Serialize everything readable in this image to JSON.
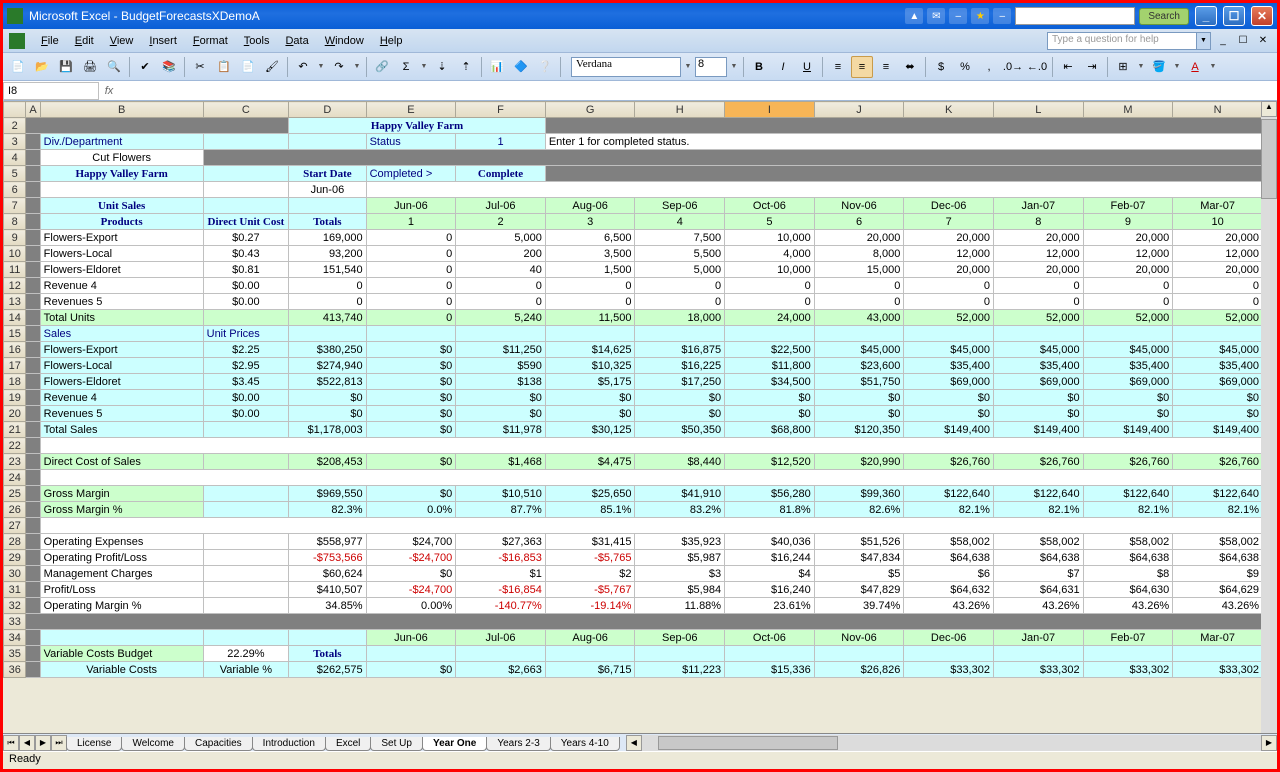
{
  "app": {
    "title": "Microsoft Excel - BudgetForecastsXDemoA",
    "search_btn": "Search"
  },
  "menus": [
    "File",
    "Edit",
    "View",
    "Insert",
    "Format",
    "Tools",
    "Data",
    "Window",
    "Help"
  ],
  "help_placeholder": "Type a question for help",
  "name_box": "I8",
  "font": {
    "name": "Verdana",
    "size": "8"
  },
  "status": "Ready",
  "tabs": [
    "License",
    "Welcome",
    "Capacities",
    "Introduction",
    "Excel",
    "Set Up",
    "Year One",
    "Years 2-3",
    "Years 4-10"
  ],
  "active_tab": "Year One",
  "cols": [
    "A",
    "B",
    "C",
    "D",
    "E",
    "F",
    "G",
    "H",
    "I",
    "J",
    "K",
    "L",
    "M",
    "N"
  ],
  "header": {
    "company": "Happy Valley Farm",
    "div_lbl": "Div./Department",
    "status_lbl": "Status",
    "status_val": "1",
    "status_hint": "Enter 1 for completed status.",
    "dept": "Cut Flowers",
    "title2": "Happy Valley Farm",
    "start_lbl": "Start Date",
    "completed_lbl": "Completed >",
    "complete_lbl": "Complete",
    "start_date": "Jun-06"
  },
  "months": [
    "Jun-06",
    "Jul-06",
    "Aug-06",
    "Sep-06",
    "Oct-06",
    "Nov-06",
    "Dec-06",
    "Jan-07",
    "Feb-07",
    "Mar-07"
  ],
  "period_nums": [
    "1",
    "2",
    "3",
    "4",
    "5",
    "6",
    "7",
    "8",
    "9",
    "10"
  ],
  "labels": {
    "unit_sales": "Unit Sales",
    "products": "Products",
    "direct_unit": "Direct Unit Cost",
    "totals": "Totals",
    "total_units": "Total Units",
    "sales": "Sales",
    "unit_prices": "Unit Prices",
    "total_sales": "Total Sales",
    "direct_cost": "Direct Cost of Sales",
    "gross_margin": "Gross Margin",
    "gross_margin_pct": "Gross Margin %",
    "op_exp": "Operating Expenses",
    "op_pl": "Operating Profit/Loss",
    "mgmt": "Management Charges",
    "pl": "Profit/Loss",
    "op_margin": "Operating Margin %",
    "var_budget": "Variable Costs Budget",
    "var_costs": "Variable Costs",
    "var_pct_lbl": "Variable %"
  },
  "rows": {
    "r9": {
      "name": "Flowers-Export",
      "cost": "$0.27",
      "total": "169,000",
      "m": [
        "0",
        "5,000",
        "6,500",
        "7,500",
        "10,000",
        "20,000",
        "20,000",
        "20,000",
        "20,000",
        "20,000"
      ]
    },
    "r10": {
      "name": "Flowers-Local",
      "cost": "$0.43",
      "total": "93,200",
      "m": [
        "0",
        "200",
        "3,500",
        "5,500",
        "4,000",
        "8,000",
        "12,000",
        "12,000",
        "12,000",
        "12,000"
      ]
    },
    "r11": {
      "name": "Flowers-Eldoret",
      "cost": "$0.81",
      "total": "151,540",
      "m": [
        "0",
        "40",
        "1,500",
        "5,000",
        "10,000",
        "15,000",
        "20,000",
        "20,000",
        "20,000",
        "20,000"
      ]
    },
    "r12": {
      "name": "Revenue 4",
      "cost": "$0.00",
      "total": "0",
      "m": [
        "0",
        "0",
        "0",
        "0",
        "0",
        "0",
        "0",
        "0",
        "0",
        "0"
      ]
    },
    "r13": {
      "name": "Revenues 5",
      "cost": "$0.00",
      "total": "0",
      "m": [
        "0",
        "0",
        "0",
        "0",
        "0",
        "0",
        "0",
        "0",
        "0",
        "0"
      ]
    },
    "r14": {
      "total": "413,740",
      "m": [
        "0",
        "5,240",
        "11,500",
        "18,000",
        "24,000",
        "43,000",
        "52,000",
        "52,000",
        "52,000",
        "52,000"
      ]
    },
    "r16": {
      "name": "Flowers-Export",
      "cost": "$2.25",
      "total": "$380,250",
      "m": [
        "$0",
        "$11,250",
        "$14,625",
        "$16,875",
        "$22,500",
        "$45,000",
        "$45,000",
        "$45,000",
        "$45,000",
        "$45,000"
      ]
    },
    "r17": {
      "name": "Flowers-Local",
      "cost": "$2.95",
      "total": "$274,940",
      "m": [
        "$0",
        "$590",
        "$10,325",
        "$16,225",
        "$11,800",
        "$23,600",
        "$35,400",
        "$35,400",
        "$35,400",
        "$35,400"
      ]
    },
    "r18": {
      "name": "Flowers-Eldoret",
      "cost": "$3.45",
      "total": "$522,813",
      "m": [
        "$0",
        "$138",
        "$5,175",
        "$17,250",
        "$34,500",
        "$51,750",
        "$69,000",
        "$69,000",
        "$69,000",
        "$69,000"
      ]
    },
    "r19": {
      "name": "Revenue 4",
      "cost": "$0.00",
      "total": "$0",
      "m": [
        "$0",
        "$0",
        "$0",
        "$0",
        "$0",
        "$0",
        "$0",
        "$0",
        "$0",
        "$0"
      ]
    },
    "r20": {
      "name": "Revenues 5",
      "cost": "$0.00",
      "total": "$0",
      "m": [
        "$0",
        "$0",
        "$0",
        "$0",
        "$0",
        "$0",
        "$0",
        "$0",
        "$0",
        "$0"
      ]
    },
    "r21": {
      "total": "$1,178,003",
      "m": [
        "$0",
        "$11,978",
        "$30,125",
        "$50,350",
        "$68,800",
        "$120,350",
        "$149,400",
        "$149,400",
        "$149,400",
        "$149,400"
      ]
    },
    "r23": {
      "total": "$208,453",
      "m": [
        "$0",
        "$1,468",
        "$4,475",
        "$8,440",
        "$12,520",
        "$20,990",
        "$26,760",
        "$26,760",
        "$26,760",
        "$26,760"
      ]
    },
    "r25": {
      "total": "$969,550",
      "m": [
        "$0",
        "$10,510",
        "$25,650",
        "$41,910",
        "$56,280",
        "$99,360",
        "$122,640",
        "$122,640",
        "$122,640",
        "$122,640"
      ]
    },
    "r26": {
      "total": "82.3%",
      "m": [
        "0.0%",
        "87.7%",
        "85.1%",
        "83.2%",
        "81.8%",
        "82.6%",
        "82.1%",
        "82.1%",
        "82.1%",
        "82.1%"
      ]
    },
    "r28": {
      "total": "$558,977",
      "m": [
        "$24,700",
        "$27,363",
        "$31,415",
        "$35,923",
        "$40,036",
        "$51,526",
        "$58,002",
        "$58,002",
        "$58,002",
        "$58,002"
      ]
    },
    "r29": {
      "total": "-$753,566",
      "m": [
        "-$24,700",
        "-$16,853",
        "-$5,765",
        "$5,987",
        "$16,244",
        "$47,834",
        "$64,638",
        "$64,638",
        "$64,638",
        "$64,638"
      ]
    },
    "r30": {
      "total": "$60,624",
      "m": [
        "$0",
        "$1",
        "$2",
        "$3",
        "$4",
        "$5",
        "$6",
        "$7",
        "$8",
        "$9"
      ]
    },
    "r31": {
      "total": "$410,507",
      "m": [
        "-$24,700",
        "-$16,854",
        "-$5,767",
        "$5,984",
        "$16,240",
        "$47,829",
        "$64,632",
        "$64,631",
        "$64,630",
        "$64,629"
      ]
    },
    "r32": {
      "total": "34.85%",
      "m": [
        "0.00%",
        "-140.77%",
        "-19.14%",
        "11.88%",
        "23.61%",
        "39.74%",
        "43.26%",
        "43.26%",
        "43.26%",
        "43.26%"
      ]
    },
    "r35": {
      "pct": "22.29%"
    },
    "r36": {
      "total": "$262,575",
      "m": [
        "$0",
        "$2,663",
        "$6,715",
        "$11,223",
        "$15,336",
        "$26,826",
        "$33,302",
        "$33,302",
        "$33,302",
        "$33,302"
      ]
    }
  }
}
